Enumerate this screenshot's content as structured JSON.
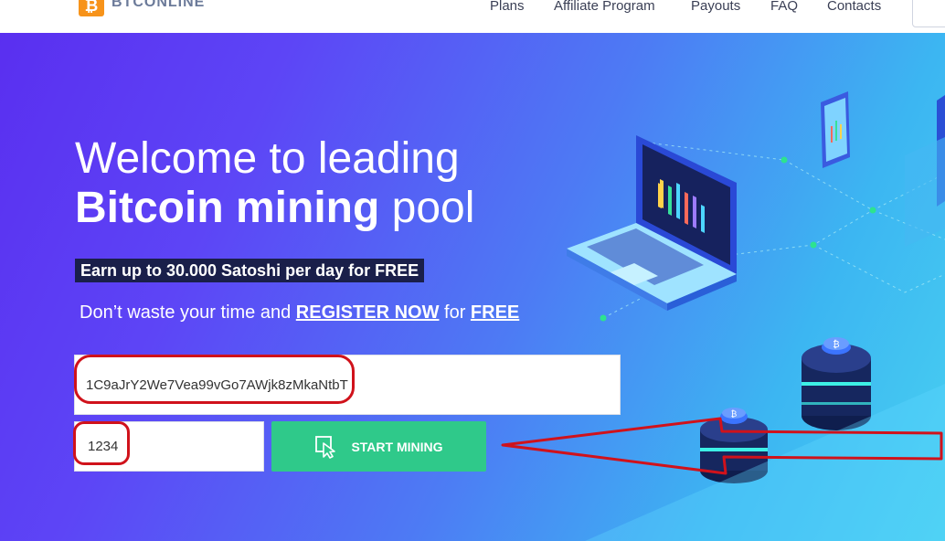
{
  "header": {
    "logo_text": "BTCONLINE",
    "logo_icon": "bitcoin-icon",
    "nav": [
      "Plans",
      "Affiliate Program",
      "Payouts",
      "FAQ",
      "Contacts"
    ]
  },
  "hero": {
    "title_line1": "Welcome to leading",
    "title_bold": "Bitcoin mining",
    "title_rest": " pool",
    "earn_banner": "Earn up to 30.000 Satoshi per day for FREE",
    "tagline_start": "Don’t waste your time and ",
    "tagline_register": "REGISTER NOW",
    "tagline_mid": " for ",
    "tagline_free": "FREE"
  },
  "form": {
    "wallet_value": "1C9aJrY2We7Vea99vGo7AWjk8zMkaNtbT",
    "pin_value": "1234",
    "start_label": "START MINING",
    "start_icon": "cursor-click-icon"
  },
  "colors": {
    "accent_green": "#2fc98a",
    "annotation_red": "#d0121b",
    "banner_dark": "#1a1f4a",
    "bitcoin_orange": "#f7931a"
  }
}
